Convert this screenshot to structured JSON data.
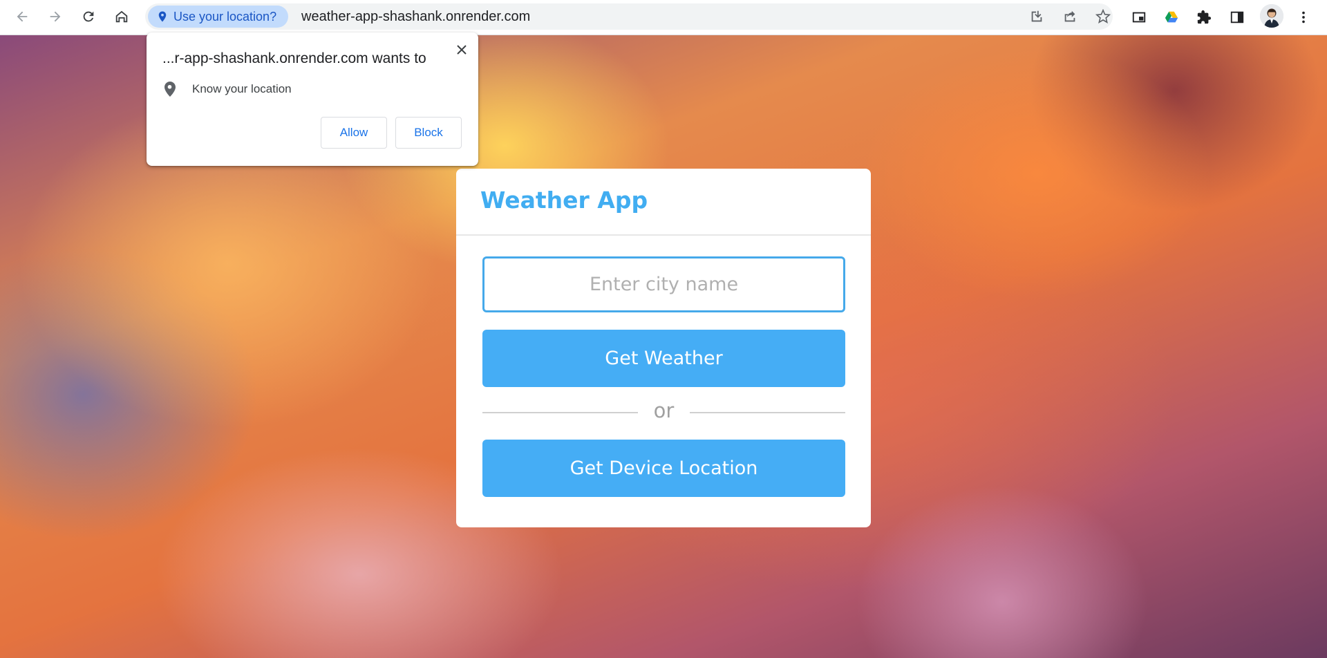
{
  "browser": {
    "location_prompt_chip": "Use your location?",
    "url": "weather-app-shashank.onrender.com",
    "icons": {
      "back": "back-arrow-icon",
      "forward": "forward-arrow-icon",
      "reload": "reload-icon",
      "home": "home-icon",
      "location": "location-pin-icon",
      "install": "install-app-icon",
      "share": "share-icon",
      "bookmark": "star-icon",
      "picture_in_picture": "picture-in-picture-icon",
      "drive": "google-drive-icon",
      "extensions": "puzzle-icon",
      "side_panel": "side-panel-icon",
      "profile": "avatar",
      "menu": "kebab-menu-icon"
    }
  },
  "permission_popup": {
    "title": "...r-app-shashank.onrender.com wants to",
    "permission": "Know your location",
    "allow_label": "Allow",
    "block_label": "Block"
  },
  "weather_app": {
    "title": "Weather App",
    "city_input": {
      "placeholder": "Enter city name",
      "value": ""
    },
    "get_weather_label": "Get Weather",
    "separator": "or",
    "get_device_location_label": "Get Device Location"
  },
  "colors": {
    "accent": "#45adf5",
    "title": "#41adf1",
    "chip_bg": "#c2dbfc",
    "link_blue": "#1a73e8"
  }
}
